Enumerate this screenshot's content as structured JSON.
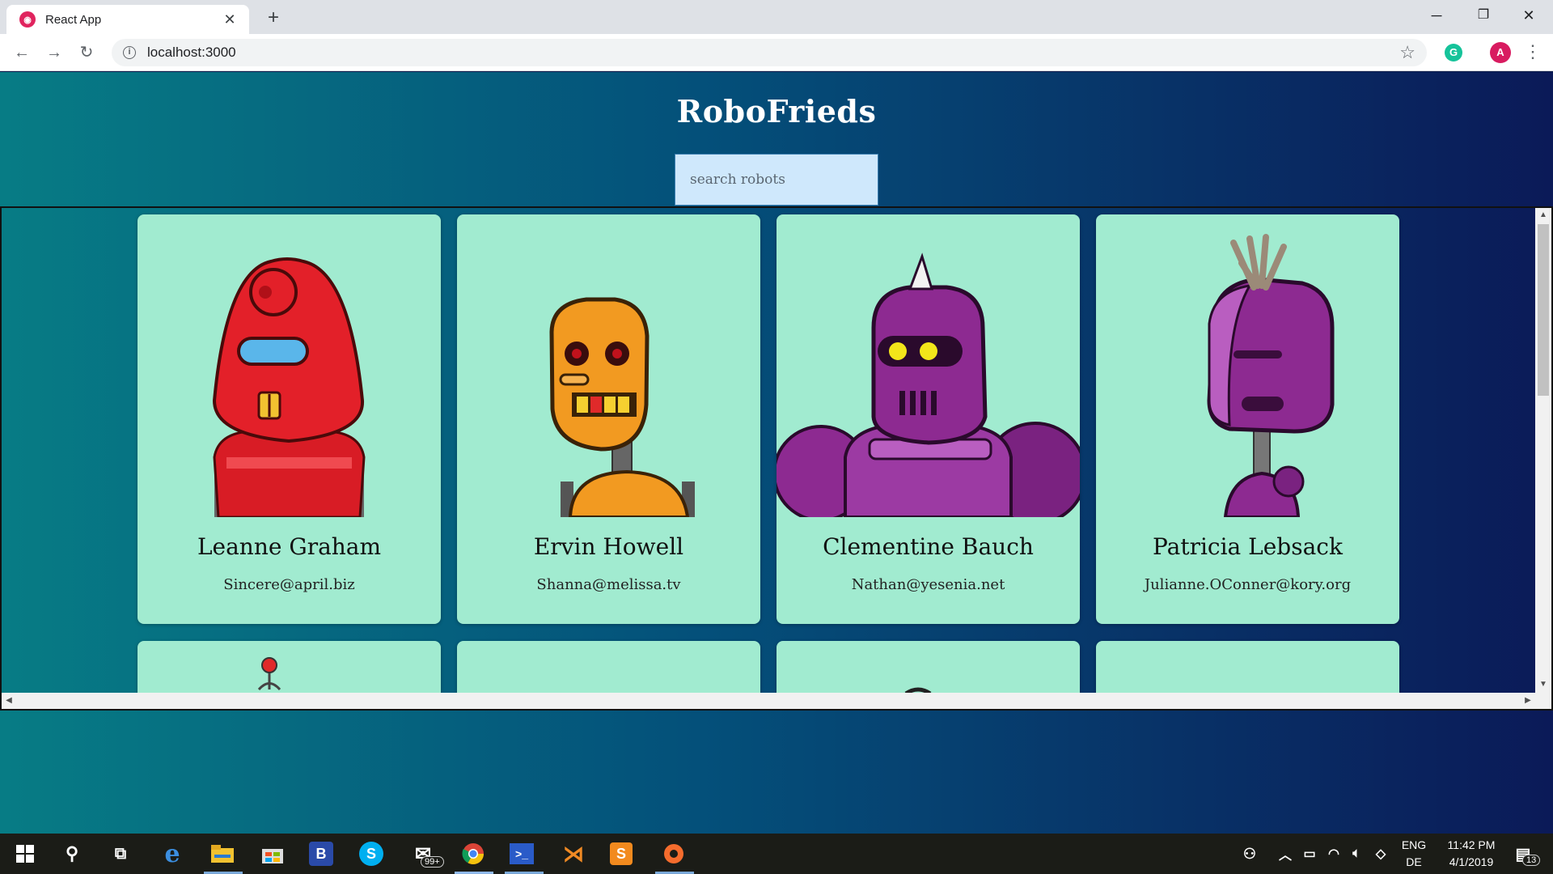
{
  "browser": {
    "tab_title": "React App",
    "url": "localhost:3000",
    "profile_initial": "A"
  },
  "page": {
    "title": "RoboFrieds",
    "search_placeholder": "search robots"
  },
  "robots": [
    {
      "name": "Leanne Graham",
      "email": "Sincere@april.biz",
      "color": "#e0202a"
    },
    {
      "name": "Ervin Howell",
      "email": "Shanna@melissa.tv",
      "color": "#f29a21"
    },
    {
      "name": "Clementine Bauch",
      "email": "Nathan@yesenia.net",
      "color": "#8d2a91"
    },
    {
      "name": "Patricia Lebsack",
      "email": "Julianne.OConner@kory.org",
      "color": "#8d2a91"
    }
  ],
  "taskbar": {
    "mail_badge": "99+",
    "lang_top": "ENG",
    "lang_bottom": "DE",
    "time": "11:42 PM",
    "date": "4/1/2019",
    "notif_count": "13"
  }
}
